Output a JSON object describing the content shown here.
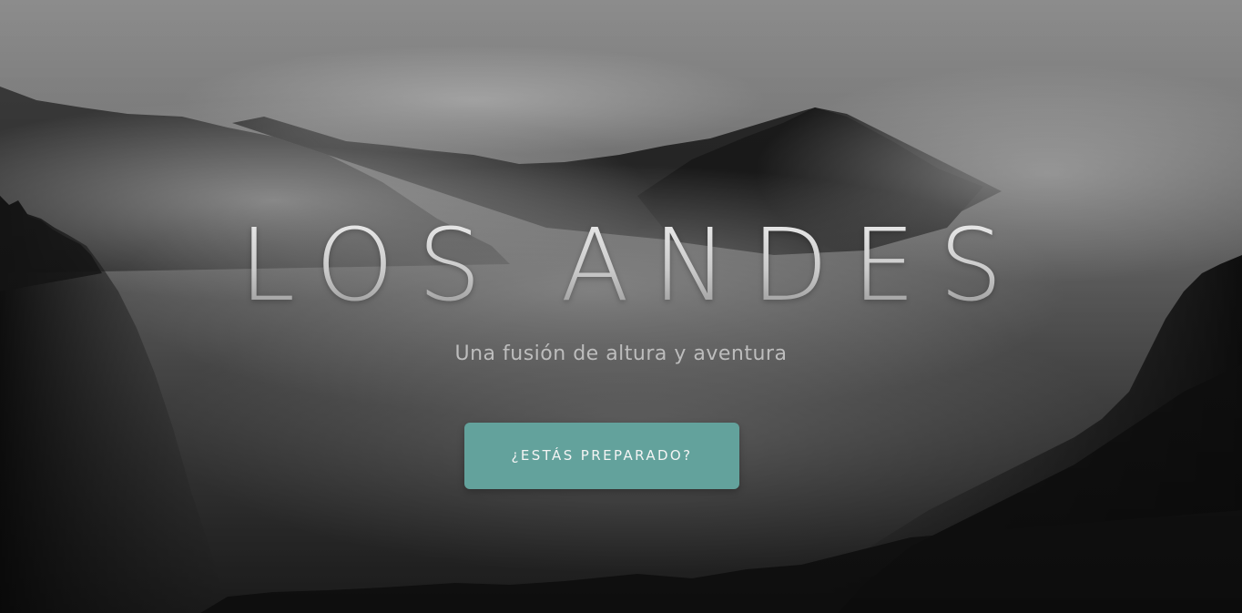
{
  "hero": {
    "title": "LOS ANDES",
    "subtitle": "Una fusión de altura y aventura",
    "cta_label": "¿ESTÁS PREPARADO?"
  },
  "colors": {
    "cta_background": "#63a29c",
    "title_text": "#d9d9d9",
    "subtitle_text": "#bdbdbd",
    "background": "#7d7d7d"
  },
  "icons": {
    "background": "misty-mountains-image"
  }
}
